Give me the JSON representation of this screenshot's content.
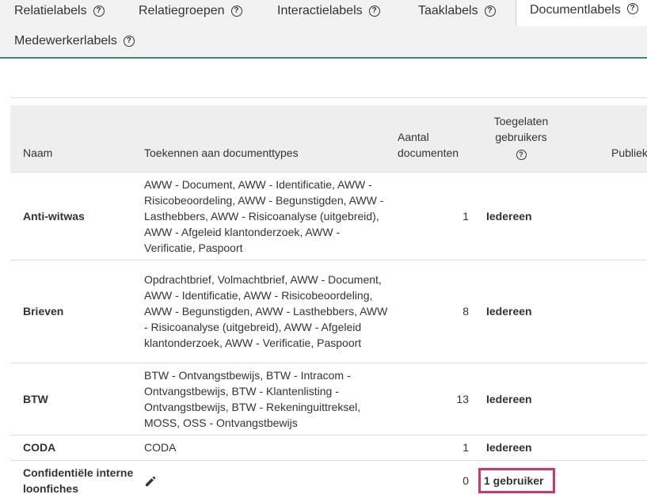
{
  "tabs": [
    {
      "label": "Relatielabels",
      "active": false
    },
    {
      "label": "Relatiegroepen",
      "active": false
    },
    {
      "label": "Interactielabels",
      "active": false
    },
    {
      "label": "Taaklabels",
      "active": false
    },
    {
      "label": "Documentlabels",
      "active": true
    },
    {
      "label": "Medewerkerlabels",
      "active": false
    }
  ],
  "help_glyph": "?",
  "table": {
    "headers": {
      "name": "Naam",
      "types": "Toekennen aan documenttypes",
      "count_line1": "Aantal",
      "count_line2": "documenten",
      "users_line1": "Toegelaten",
      "users_line2": "gebruikers",
      "public": "Publiek op"
    },
    "rows": [
      {
        "name": "Anti-witwas",
        "types": "AWW - Document, AWW - Identificatie, AWW - Risicobeoordeling, AWW - Begunstigden, AWW - Lasthebbers, AWW - Risicoanalyse (uitgebreid), AWW - Afgeleid klantonderzoek, AWW - Verificatie, Paspoort",
        "count": "1",
        "users": "Iedereen"
      },
      {
        "name": "Brieven",
        "types": "Opdrachtbrief, Volmachtbrief, AWW - Document, AWW - Identificatie, AWW - Risicobeoordeling, AWW - Begunstigden, AWW - Lasthebbers, AWW - Risicoanalyse (uitgebreid), AWW - Afgeleid klantonderzoek, AWW - Verificatie, Paspoort",
        "count": "8",
        "users": "Iedereen"
      },
      {
        "name": "BTW",
        "types": "BTW - Ontvangstbewijs, BTW - Intracom - Ontvangstbewijs, BTW - Klantenlisting - Ontvangstbewijs, BTW - Rekeninguittreksel, MOSS, OSS - Ontvangstbewijs",
        "count": "13",
        "users": "Iedereen"
      },
      {
        "name": "CODA",
        "types": "CODA",
        "count": "1",
        "users": "Iedereen"
      },
      {
        "name": "Confidentiële interne loonfiches",
        "types": "",
        "count": "0",
        "users": "1 gebruiker"
      }
    ]
  },
  "colors": {
    "tab_underline": "#3b8b7d",
    "highlight_border": "#d6336c",
    "header_bg": "#eeeeee"
  }
}
